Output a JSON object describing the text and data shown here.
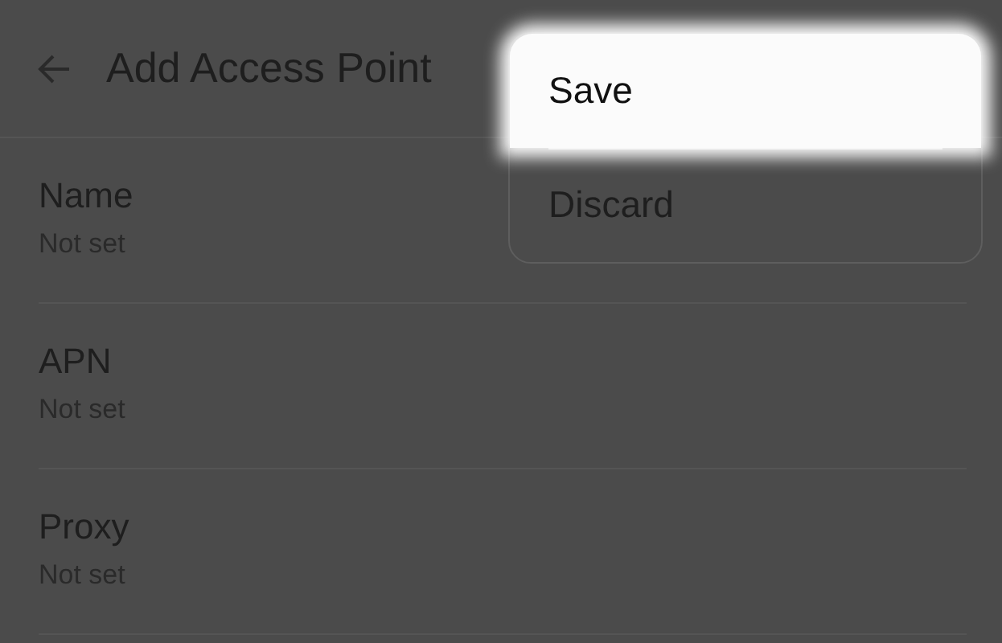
{
  "header": {
    "title": "Add Access Point"
  },
  "fields": [
    {
      "label": "Name",
      "value": "Not set"
    },
    {
      "label": "APN",
      "value": "Not set"
    },
    {
      "label": "Proxy",
      "value": "Not set"
    }
  ],
  "menu": {
    "items": [
      {
        "label": "Save",
        "highlighted": true
      },
      {
        "label": "Discard",
        "highlighted": false
      }
    ]
  }
}
